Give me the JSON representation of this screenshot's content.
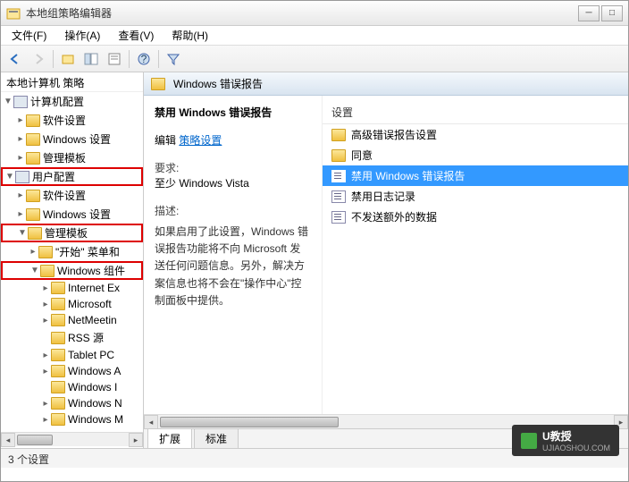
{
  "window": {
    "title": "本地组策略编辑器"
  },
  "menu": {
    "file": "文件(F)",
    "action": "操作(A)",
    "view": "查看(V)",
    "help": "帮助(H)"
  },
  "tree": {
    "root": "本地计算机 策略",
    "computer_config": "计算机配置",
    "software_settings1": "软件设置",
    "windows_settings1": "Windows 设置",
    "admin_templates1": "管理模板",
    "user_config": "用户配置",
    "software_settings2": "软件设置",
    "windows_settings2": "Windows 设置",
    "admin_templates2": "管理模板",
    "start_menu": "\"开始\" 菜单和",
    "windows_components": "Windows 组件",
    "internet_ex": "Internet Ex",
    "microsoft": "Microsoft",
    "netmeeting": "NetMeetin",
    "rss": "RSS 源",
    "tablet_pc": "Tablet PC",
    "windows_a": "Windows A",
    "windows_i": "Windows I",
    "windows_n": "Windows N",
    "windows_m": "Windows M"
  },
  "content": {
    "header": "Windows 错误报告",
    "title": "禁用 Windows 错误报告",
    "edit_label": "编辑",
    "edit_link": "策略设置",
    "req_label": "要求:",
    "req_value": "至少 Windows Vista",
    "desc_label": "描述:",
    "desc_text": "如果启用了此设置，Windows 错误报告功能将不向 Microsoft 发送任何问题信息。另外，解决方案信息也将不会在\"操作中心\"控制面板中提供。"
  },
  "list": {
    "column": "设置",
    "items": [
      "高级错误报告设置",
      "同意",
      "禁用 Windows 错误报告",
      "禁用日志记录",
      "不发送额外的数据"
    ]
  },
  "tabs": {
    "extended": "扩展",
    "standard": "标准"
  },
  "status": "3 个设置",
  "watermark": {
    "brand": "U教授",
    "url": "UJIAOSHOU.COM"
  }
}
